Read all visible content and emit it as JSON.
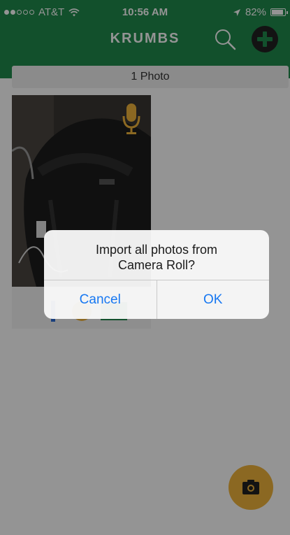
{
  "status_bar": {
    "carrier": "AT&T",
    "time": "10:56 AM",
    "battery": "82%",
    "battery_level": 0.82,
    "signal_dots_filled": 2,
    "signal_dots_total": 5
  },
  "nav": {
    "title": "KRUMBS",
    "icons": [
      "search-icon",
      "add-icon"
    ]
  },
  "gallery": {
    "count_label": "1 Photo"
  },
  "fab": {
    "icon": "camera-icon"
  },
  "alert": {
    "message": "Import all photos from\nCamera Roll?",
    "cancel_label": "Cancel",
    "ok_label": "OK"
  },
  "colors": {
    "nav_green": "#1f8a4c",
    "accent_orange": "#f0b43b",
    "ios_blue": "#1778f2"
  }
}
